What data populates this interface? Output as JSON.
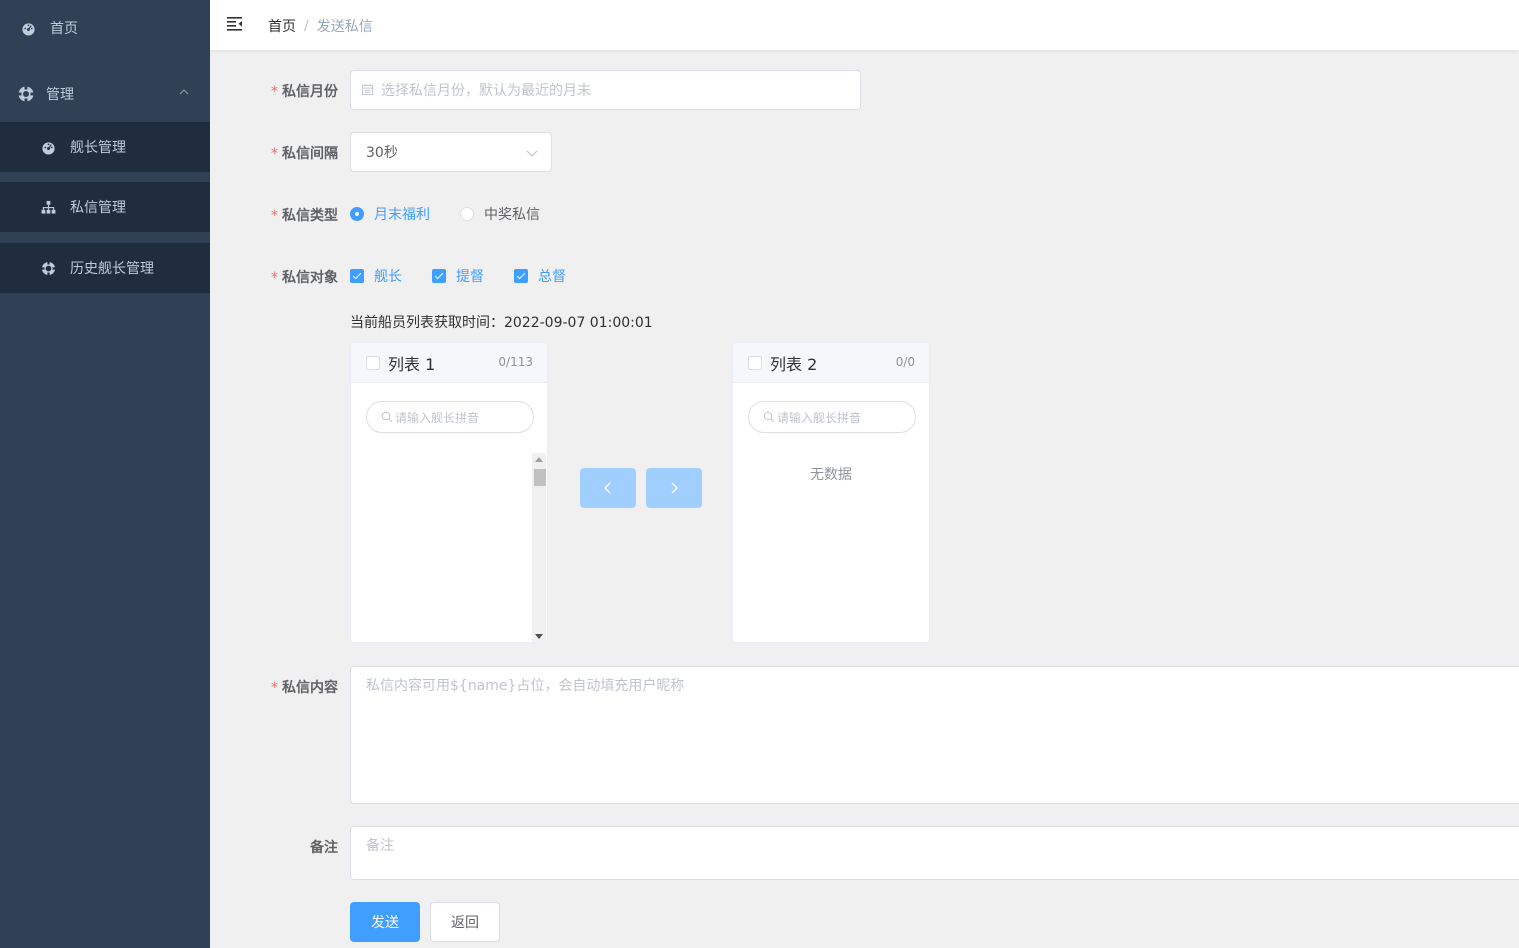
{
  "sidebar": {
    "home": {
      "label": "首页",
      "icon": "dashboard-icon"
    },
    "manage": {
      "label": "管理",
      "icon": "circle-icon"
    },
    "items": [
      {
        "label": "舰长管理",
        "icon": "dashboard-icon"
      },
      {
        "label": "私信管理",
        "icon": "tree-icon"
      },
      {
        "label": "历史舰长管理",
        "icon": "lifebuoy-icon"
      }
    ]
  },
  "breadcrumb": {
    "home": "首页",
    "separator": "/",
    "current": "发送私信"
  },
  "form": {
    "month": {
      "label": "私信月份",
      "placeholder": "选择私信月份，默认为最近的月末"
    },
    "interval": {
      "label": "私信间隔",
      "value": "30秒"
    },
    "type": {
      "label": "私信类型",
      "options": [
        "月末福利",
        "中奖私信"
      ],
      "selected": "月末福利"
    },
    "target": {
      "label": "私信对象",
      "options": [
        "舰长",
        "提督",
        "总督"
      ]
    },
    "fetch_time": "当前船员列表获取时间：2022-09-07 01:00:01",
    "transfer": {
      "left": {
        "title": "列表 1",
        "count": "0/113",
        "search_placeholder": "请输入舰长拼音"
      },
      "right": {
        "title": "列表 2",
        "count": "0/0",
        "search_placeholder": "请输入舰长拼音",
        "empty": "无数据"
      }
    },
    "content": {
      "label": "私信内容",
      "placeholder": "私信内容可用${name}占位，会自动填充用户昵称"
    },
    "remark": {
      "label": "备注",
      "placeholder": "备注"
    },
    "buttons": {
      "send": "发送",
      "back": "返回"
    }
  },
  "colors": {
    "sidebar_bg": "#304156",
    "submenu_bg": "#1f2d3d",
    "primary": "#409eff",
    "required_star": "#f56c6c"
  }
}
